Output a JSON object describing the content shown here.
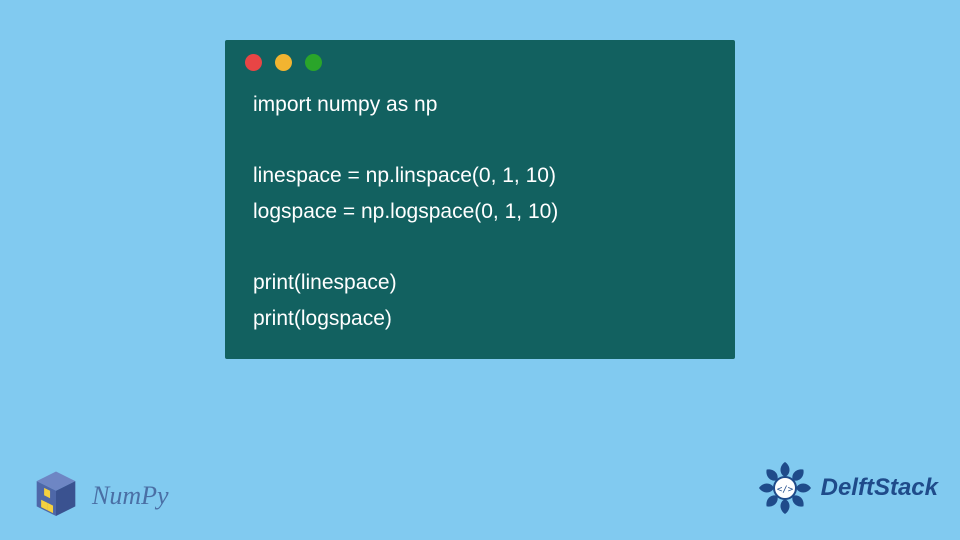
{
  "code": {
    "lines": [
      "import numpy as np",
      "",
      "linespace = np.linspace(0, 1, 10)",
      "logspace = np.logspace(0, 1, 10)",
      "",
      "print(linespace)",
      "print(logspace)"
    ]
  },
  "window": {
    "dots": [
      "red",
      "yellow",
      "green"
    ]
  },
  "branding": {
    "numpy_label": "NumPy",
    "delft_label": "DelftStack"
  },
  "colors": {
    "page_bg": "#81caf0",
    "window_bg": "#126160",
    "code_text": "#ffffff",
    "numpy_text": "#4a6fa5",
    "delft_text": "#1f4b8a"
  }
}
